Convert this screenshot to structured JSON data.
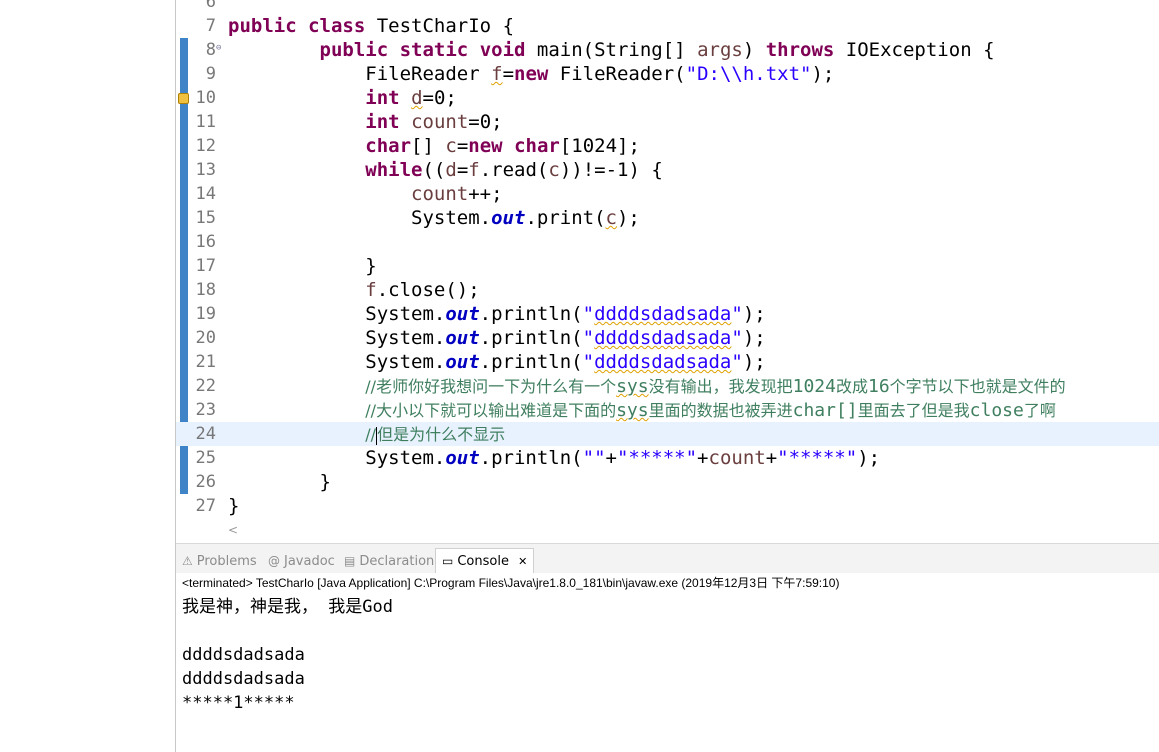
{
  "editor": {
    "lines": [
      {
        "num": "6",
        "html": ""
      },
      {
        "num": "7",
        "html": "<span class=\"kw\">public</span> <span class=\"kw\">class</span> TestCharIo {"
      },
      {
        "num": "8",
        "fold": true,
        "html": "        <span class=\"kw\">public</span> <span class=\"kw\">static</span> <span class=\"kw\">void</span> main(String[] <span class=\"var\">args</span>) <span class=\"kw\">throws</span> IOException {"
      },
      {
        "num": "9",
        "html": "            FileReader <span class=\"var sq\">f</span>=<span class=\"kw\">new</span> FileReader(<span class=\"str\">\"D:\\\\h.txt\"</span>);"
      },
      {
        "num": "10",
        "warn": true,
        "html": "            <span class=\"kw\">int</span> <span class=\"var sq\">d</span>=0;"
      },
      {
        "num": "11",
        "html": "            <span class=\"kw\">int</span> <span class=\"var\">count</span>=0;"
      },
      {
        "num": "12",
        "html": "            <span class=\"kw\">char</span>[] <span class=\"var\">c</span>=<span class=\"kw\">new</span> <span class=\"kw\">char</span>[1024];"
      },
      {
        "num": "13",
        "html": "            <span class=\"kw\">while</span>((<span class=\"var\">d</span>=<span class=\"var\">f</span>.read(<span class=\"var\">c</span>))!=-1) {"
      },
      {
        "num": "14",
        "html": "                <span class=\"var\">count</span>++;"
      },
      {
        "num": "15",
        "html": "                System.<span class=\"fld\">out</span>.print(<span class=\"var sq\">c</span>);"
      },
      {
        "num": "16",
        "html": ""
      },
      {
        "num": "17",
        "html": "            }"
      },
      {
        "num": "18",
        "html": "            <span class=\"var\">f</span>.close();"
      },
      {
        "num": "19",
        "html": "            System.<span class=\"fld\">out</span>.println(<span class=\"str\">\"<span class=\"sq\">ddddsdadsada</span>\"</span>);"
      },
      {
        "num": "20",
        "html": "            System.<span class=\"fld\">out</span>.println(<span class=\"str\">\"<span class=\"sq\">ddddsdadsada</span>\"</span>);"
      },
      {
        "num": "21",
        "html": "            System.<span class=\"fld\">out</span>.println(<span class=\"str\">\"<span class=\"sq\">ddddsdadsada</span>\"</span>);"
      },
      {
        "num": "22",
        "html": "            <span class=\"cmt\">//老师你好我想问一下为什么有一个<span class=\"m sq\">sys</span>没有输出，我发现把<span class=\"m\">1024</span>改成<span class=\"m\">16</span>个字节以下也就是文件的</span>"
      },
      {
        "num": "23",
        "html": "            <span class=\"cmt\">//大小以下就可以输出难道是下面的<span class=\"m sq\">sys</span>里面的数据也被弄进<span class=\"m\">char[]</span>里面去了但是我<span class=\"m\">close</span>了啊</span>"
      },
      {
        "num": "24",
        "current": true,
        "html": "            <span class=\"cmt\">//<span class=\"caret\"></span>但是为什么不显示</span>"
      },
      {
        "num": "25",
        "html": "            System.<span class=\"fld\">out</span>.println(<span class=\"str\">\"\"</span>+<span class=\"str\">\"*****\"</span>+<span class=\"var\">count</span>+<span class=\"str\">\"*****\"</span>);"
      },
      {
        "num": "26",
        "html": "        }"
      },
      {
        "num": "27",
        "html": "}"
      }
    ]
  },
  "tabs": [
    {
      "label": "Problems",
      "icon": "⚠",
      "active": false
    },
    {
      "label": "Javadoc",
      "icon": "@",
      "active": false
    },
    {
      "label": "Declaration",
      "icon": "▤",
      "active": false
    },
    {
      "label": "Console",
      "icon": "▭",
      "active": true,
      "close": "✕"
    }
  ],
  "console": {
    "status": "<terminated> TestCharIo [Java Application] C:\\Program Files\\Java\\jre1.8.0_181\\bin\\javaw.exe (2019年12月3日 下午7:59:10)",
    "output": [
      "我是神，神是我， 我是God",
      "",
      "ddddsdadsada",
      "ddddsdadsada",
      "*****1*****"
    ]
  },
  "colors": {
    "keyword": "#7f0055",
    "string": "#2a00ff",
    "field": "#0000c0",
    "comment": "#3f7f5f",
    "variable": "#6a3e3e",
    "ruler": "#3f84c7",
    "current_line": "#e8f2fe"
  }
}
